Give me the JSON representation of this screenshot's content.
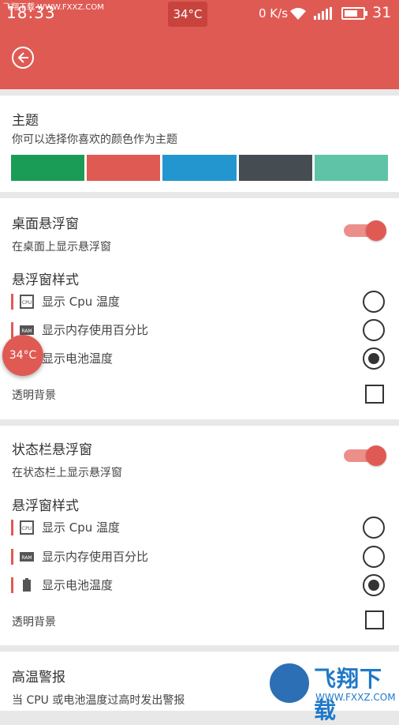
{
  "watermark": {
    "top_left": "飞翔下载 WWW.FXXZ.COM",
    "logo_text": "飞翔下载",
    "logo_url": "WWW.FXXZ.COM"
  },
  "status_bar": {
    "time": "18:33",
    "temperature": "34°C",
    "net_speed": "0 K/s",
    "battery": "31"
  },
  "theme": {
    "title": "主题",
    "subtitle": "你可以选择你喜欢的颜色作为主题",
    "swatches": [
      "#1a9c56",
      "#e05a54",
      "#2396cf",
      "#454c52",
      "#5ec3a7"
    ]
  },
  "desktop": {
    "title": "桌面悬浮窗",
    "subtitle": "在桌面上显示悬浮窗",
    "toggle_on": true,
    "style_title": "悬浮窗样式",
    "options": [
      {
        "icon": "cpu-icon",
        "label": "显示 Cpu 温度",
        "selected": false
      },
      {
        "icon": "ram-icon",
        "label": "显示内存使用百分比",
        "selected": false
      },
      {
        "icon": "battery-icon",
        "label": "显示电池温度",
        "selected": true
      }
    ],
    "transparent_label": "透明背景",
    "transparent_checked": false
  },
  "statusbar_float": {
    "title": "状态栏悬浮窗",
    "subtitle": "在状态栏上显示悬浮窗",
    "toggle_on": true,
    "style_title": "悬浮窗样式",
    "options": [
      {
        "icon": "cpu-icon",
        "label": "显示 Cpu 温度",
        "selected": false
      },
      {
        "icon": "ram-icon",
        "label": "显示内存使用百分比",
        "selected": false
      },
      {
        "icon": "battery-icon",
        "label": "显示电池温度",
        "selected": true
      }
    ],
    "transparent_label": "透明背景",
    "transparent_checked": false
  },
  "alarm": {
    "title": "高温警报",
    "subtitle": "当 CPU 或电池温度过高时发出警报"
  },
  "float_bubble": {
    "text": "34°C"
  }
}
